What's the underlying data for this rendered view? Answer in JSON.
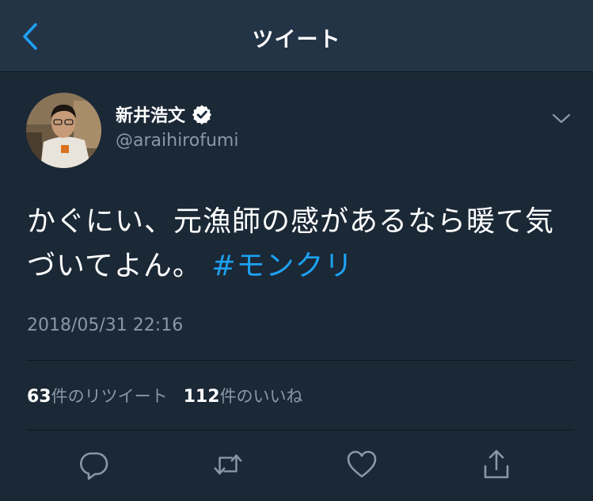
{
  "header": {
    "title": "ツイート",
    "back_icon": "chevron-left-icon"
  },
  "author": {
    "display_name": "新井浩文",
    "handle": "@araihirofumi",
    "verified": true
  },
  "tweet": {
    "text": "かぐにい、元漁師の感があるなら暖て気づいてよん。",
    "hashtag": "#モンクリ",
    "timestamp": "2018/05/31 22:16"
  },
  "stats": {
    "retweet_count": "63",
    "retweet_label": "件のリツイート",
    "like_count": "112",
    "like_label": "件のいいね"
  },
  "actions": [
    "reply-icon",
    "retweet-icon",
    "like-icon",
    "share-icon"
  ],
  "colors": {
    "background": "#1b2836",
    "header": "#243447",
    "secondary_text": "#8899a6",
    "accent": "#1da1f2"
  }
}
